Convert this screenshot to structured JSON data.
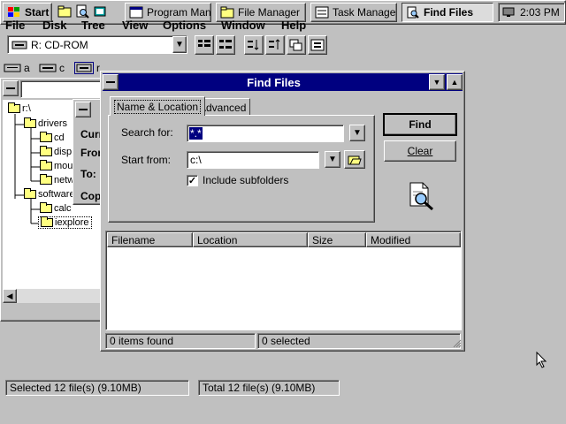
{
  "taskbar": {
    "start_label": "Start",
    "tasks": [
      {
        "label": "Program Man..."
      },
      {
        "label": "File Manager"
      },
      {
        "label": "Task Manager"
      },
      {
        "label": "Find Files"
      }
    ],
    "clock": "2:03 PM"
  },
  "file_manager": {
    "menu": [
      "File",
      "Disk",
      "Tree",
      "View",
      "Options",
      "Window",
      "Help"
    ],
    "drive_combo": "R: CD-ROM",
    "drive_bar": [
      {
        "letter": "a"
      },
      {
        "letter": "c"
      },
      {
        "letter": "r"
      }
    ],
    "tree_path": "r:\\",
    "tree": [
      {
        "label": "r:\\"
      },
      {
        "label": "drivers"
      },
      {
        "label": "cd"
      },
      {
        "label": "disp"
      },
      {
        "label": "mou"
      },
      {
        "label": "netw"
      },
      {
        "label": "software"
      },
      {
        "label": "calc"
      },
      {
        "label": "iexplore"
      }
    ],
    "behind_dialog": {
      "labels": [
        "Curr",
        "From",
        "To:",
        "Copy"
      ]
    },
    "status_left": "Selected 12 file(s) (9.10MB)",
    "status_right": "Total 12 file(s) (9.10MB)"
  },
  "find_files": {
    "title": "Find Files",
    "tabs": [
      "Name & Location",
      "Advanced"
    ],
    "search_for_label": "Search for:",
    "search_for_value": "*.*",
    "start_from_label": "Start from:",
    "start_from_value": "c:\\",
    "include_subfolders_label": "Include subfolders",
    "include_subfolders_checked": true,
    "find_button": "Find",
    "clear_button": "Clear",
    "columns": [
      "Filename",
      "Location",
      "Size",
      "Modified"
    ],
    "status_found": "0 items found",
    "status_selected": "0 selected"
  }
}
